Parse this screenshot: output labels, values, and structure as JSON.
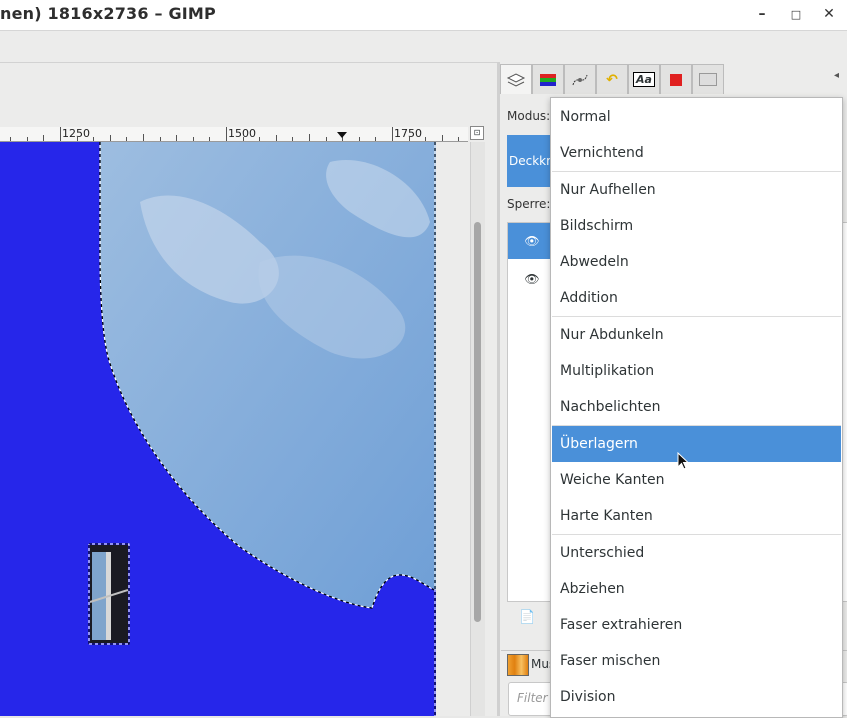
{
  "window": {
    "title": "nen) 1816x2736 – GIMP",
    "minimize": "–",
    "maximize": "□",
    "close": "✕"
  },
  "ruler": {
    "labels": [
      "1250",
      "1500",
      "1750"
    ]
  },
  "panel": {
    "tabs": [
      "layers-icon",
      "channels-icon",
      "paths-icon",
      "undo-icon",
      "text-icon",
      "color-icon",
      "images-icon"
    ],
    "text_tab": "Aa",
    "mode_label": "Modus:",
    "opacity_partial": "Deckkr",
    "lock_label": "Sperre:",
    "bottom_tab_label": "Mus",
    "filter_placeholder": "Filter"
  },
  "blend_menu": {
    "items": [
      {
        "label": "Normal",
        "group": 1
      },
      {
        "label": "Vernichtend",
        "group": 1
      },
      {
        "label": "Nur Aufhellen",
        "group": 2
      },
      {
        "label": "Bildschirm",
        "group": 2
      },
      {
        "label": "Abwedeln",
        "group": 2
      },
      {
        "label": "Addition",
        "group": 2
      },
      {
        "label": "Nur Abdunkeln",
        "group": 3
      },
      {
        "label": "Multiplikation",
        "group": 3
      },
      {
        "label": "Nachbelichten",
        "group": 3
      },
      {
        "label": "Überlagern",
        "group": 4,
        "highlighted": true
      },
      {
        "label": "Weiche Kanten",
        "group": 4
      },
      {
        "label": "Harte Kanten",
        "group": 4
      },
      {
        "label": "Unterschied",
        "group": 5
      },
      {
        "label": "Abziehen",
        "group": 5
      },
      {
        "label": "Faser extrahieren",
        "group": 5
      },
      {
        "label": "Faser mischen",
        "group": 5
      },
      {
        "label": "Division",
        "group": 5
      }
    ]
  },
  "colors": {
    "canvas_blue": "#2626ea",
    "sky": "#8fb4dc",
    "highlight": "#4a90d9"
  }
}
